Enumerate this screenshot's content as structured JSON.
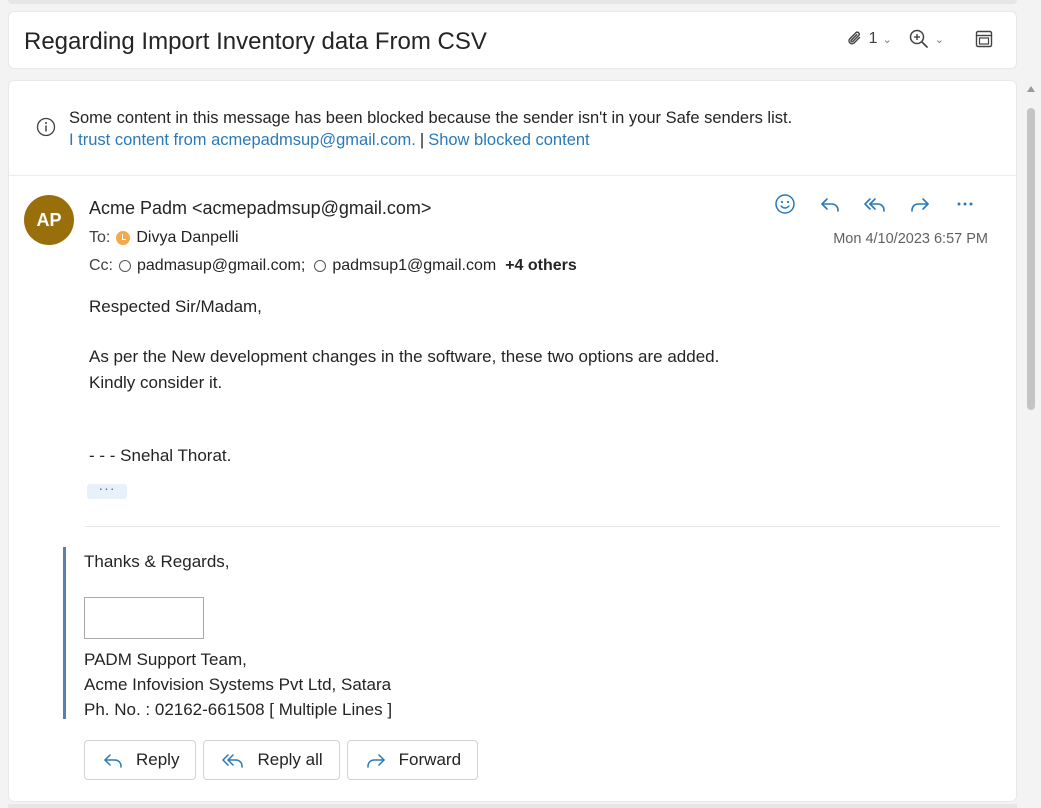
{
  "subject": "Regarding Import Inventory data From CSV",
  "toolbar": {
    "attachment_count": "1",
    "attachment_icon": "paperclip-icon",
    "zoom_icon": "zoom-in-icon",
    "popout_icon": "open-in-new-window-icon"
  },
  "blocked_banner": {
    "message": "Some content in this message has been blocked because the sender isn't in your Safe senders list.",
    "trust_link": "I trust content from acmepadmsup@gmail.com.",
    "separator": "|",
    "show_link": "Show blocked content"
  },
  "email": {
    "avatar_initials": "AP",
    "avatar_color": "#986f0b",
    "sender": "Acme Padm <acmepadmsup@gmail.com>",
    "to_label": "To:",
    "to": "Divya Danpelli",
    "cc_label": "Cc:",
    "cc": [
      "padmasup@gmail.com;",
      "padmsup1@gmail.com"
    ],
    "cc_more": "+4 others",
    "date": "Mon 4/10/2023 6:57 PM",
    "body": {
      "greeting": "Respected Sir/Madam,",
      "line1": "As per the New development changes in the software, these two options are added.",
      "line2": "Kindly consider it.",
      "signoff": "- - - Snehal Thorat."
    },
    "expand_label": "···"
  },
  "signature": {
    "thanks": "Thanks & Regards,",
    "team": "PADM Support Team,",
    "company": "Acme Infovision Systems Pvt Ltd, Satara",
    "phone": "Ph. No. : 02162-661508 [ Multiple Lines ]"
  },
  "reply_buttons": {
    "reply": "Reply",
    "reply_all": "Reply all",
    "forward": "Forward"
  },
  "colors": {
    "accent": "#2b79b6",
    "link": "#2b79b6",
    "quote_bar": "#5a7fa8"
  }
}
